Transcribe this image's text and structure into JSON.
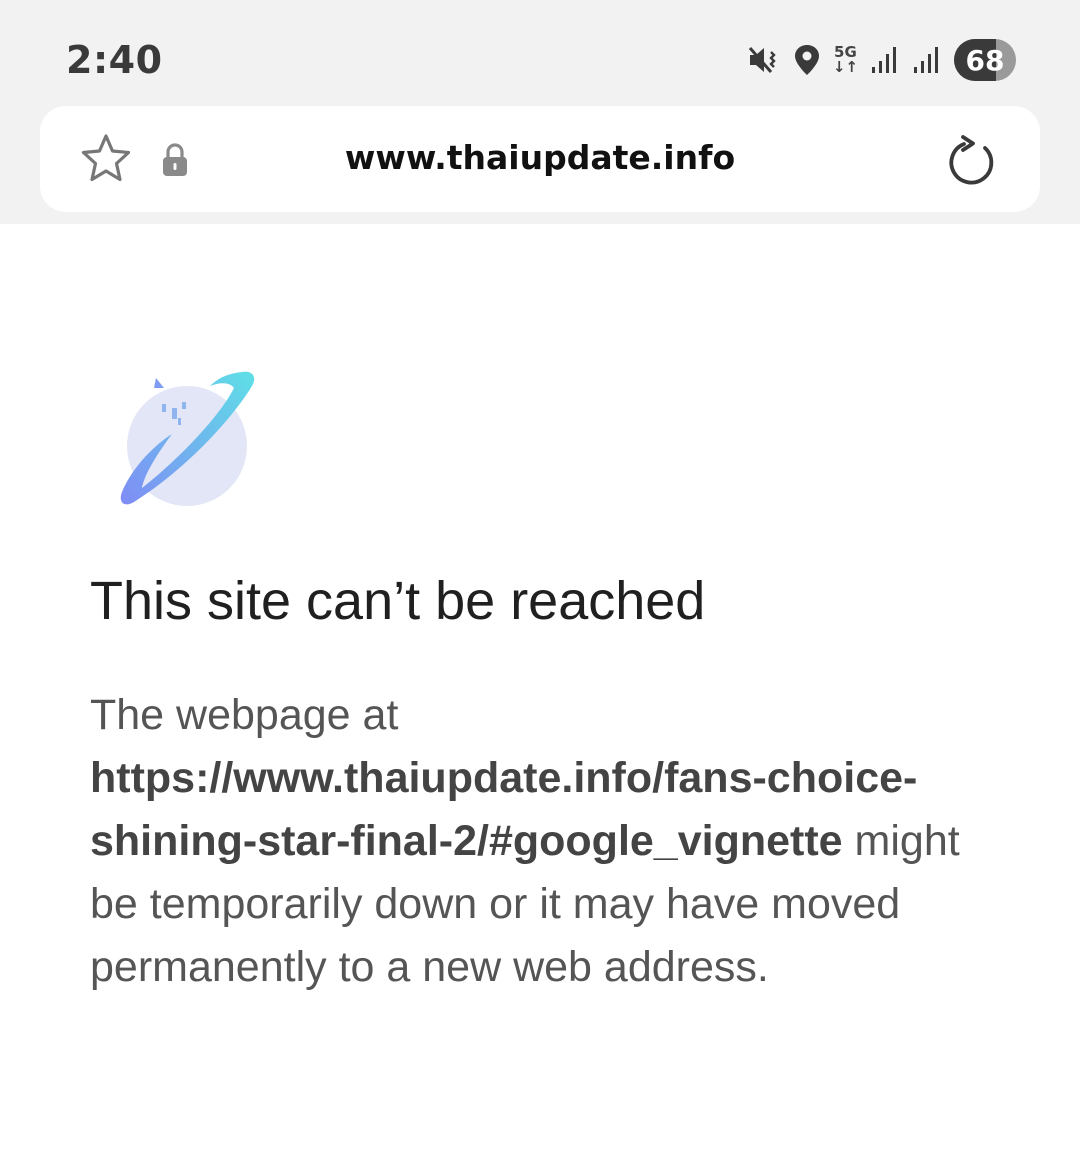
{
  "status_bar": {
    "time": "2:40",
    "network_type_top": "5G",
    "network_type_bottom": "↓↑",
    "battery_level": "68",
    "battery_fraction": 0.68,
    "icons": [
      "mute-vibrate-icon",
      "location-icon",
      "5g-icon",
      "signal-icon",
      "signal-icon",
      "battery-icon"
    ]
  },
  "browser": {
    "url": "www.thaiupdate.info",
    "icons": [
      "star-icon",
      "lock-icon",
      "reload-icon"
    ]
  },
  "error_page": {
    "title": "This site can’t be reached",
    "body_prefix": "The webpage at ",
    "body_url": "https://www.thaiupdate.info/fans-choice-shining-star-final-2/#google_vignette",
    "body_suffix": " might be temporarily down or it may have moved permanently to a new web address.",
    "graphic_icon": "globe-error-icon"
  },
  "colors": {
    "chrome_background": "#f2f2f2",
    "page_background": "#ffffff",
    "title_text": "#202020",
    "body_text": "#555555",
    "graphic_accent_start": "#5ee0e6",
    "graphic_accent_end": "#7f8cf5",
    "graphic_globe": "#e3e6f6"
  }
}
